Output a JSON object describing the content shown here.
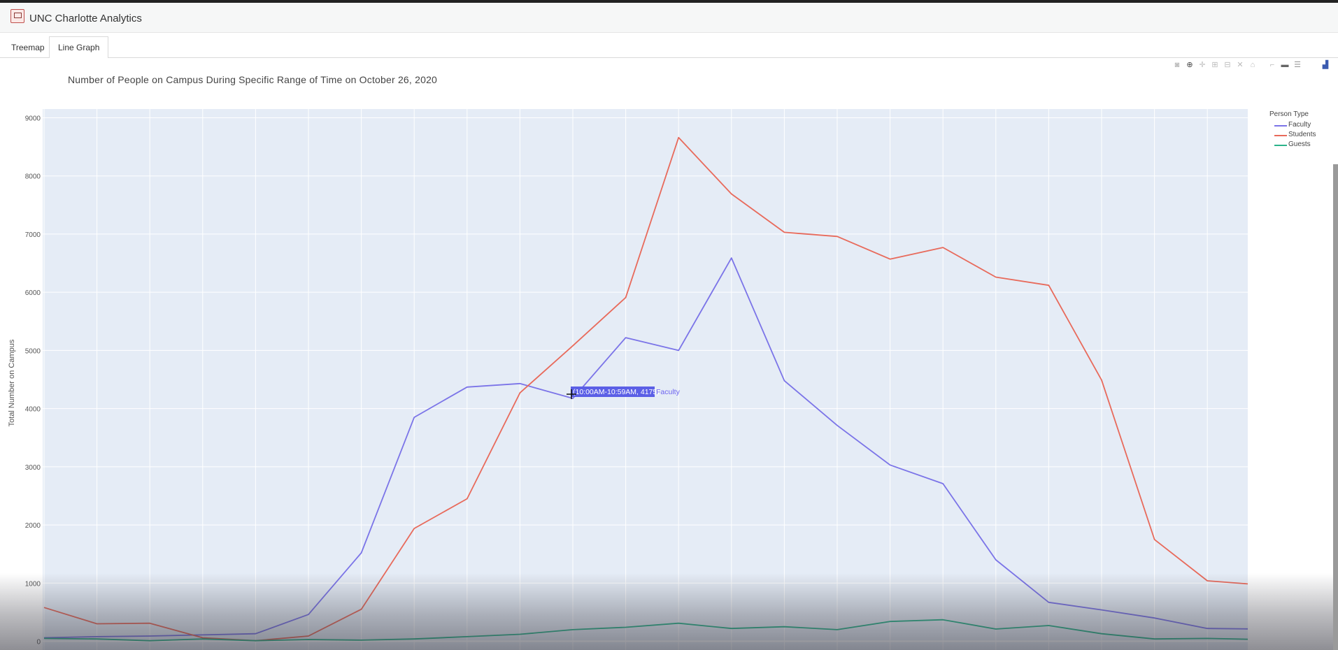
{
  "app": {
    "title": "UNC Charlotte Analytics"
  },
  "tabs": [
    {
      "label": "Treemap"
    },
    {
      "label": "Line Graph"
    }
  ],
  "modebar": [
    "camera-icon",
    "zoom-icon",
    "pan-icon",
    "zoom-in-icon",
    "zoom-out-icon",
    "autoscale-icon",
    "home-icon",
    "spike-icon",
    "hover-closest-icon",
    "hover-compare-icon",
    "plotly-logo-icon"
  ],
  "hover": {
    "label": "(10:00AM-10:59AM, 4175)",
    "series": "Faculty",
    "color": "#6d63f0"
  },
  "chart_data": {
    "type": "line",
    "title": "Number of People on Campus During Specific Range of Time on October 26, 2020",
    "xlabel": "",
    "ylabel": "Total Number on Campus",
    "ylim": [
      -150,
      9150
    ],
    "yticks": [
      0,
      1000,
      2000,
      3000,
      4000,
      5000,
      6000,
      7000,
      8000,
      9000
    ],
    "grid": true,
    "legend_title": "Person Type",
    "legend_position": "top-right",
    "series": [
      {
        "name": "Faculty",
        "color": "#7b74e8",
        "values": [
          60,
          80,
          90,
          110,
          130,
          460,
          1520,
          3850,
          4370,
          4430,
          4175,
          5220,
          5000,
          6590,
          4480,
          3710,
          3030,
          2710,
          1400,
          670,
          540,
          400,
          220,
          210
        ]
      },
      {
        "name": "Students",
        "color": "#e86a5b",
        "values": [
          580,
          300,
          310,
          60,
          10,
          90,
          550,
          1940,
          2450,
          4270,
          5080,
          5910,
          8660,
          7690,
          7030,
          6960,
          6570,
          6770,
          6260,
          6120,
          4490,
          1750,
          1040,
          970
        ]
      },
      {
        "name": "Guests",
        "color": "#2bb38a",
        "values": [
          50,
          40,
          10,
          40,
          10,
          30,
          20,
          40,
          80,
          120,
          200,
          240,
          310,
          220,
          250,
          200,
          340,
          370,
          210,
          270,
          130,
          40,
          50,
          30
        ]
      }
    ]
  }
}
